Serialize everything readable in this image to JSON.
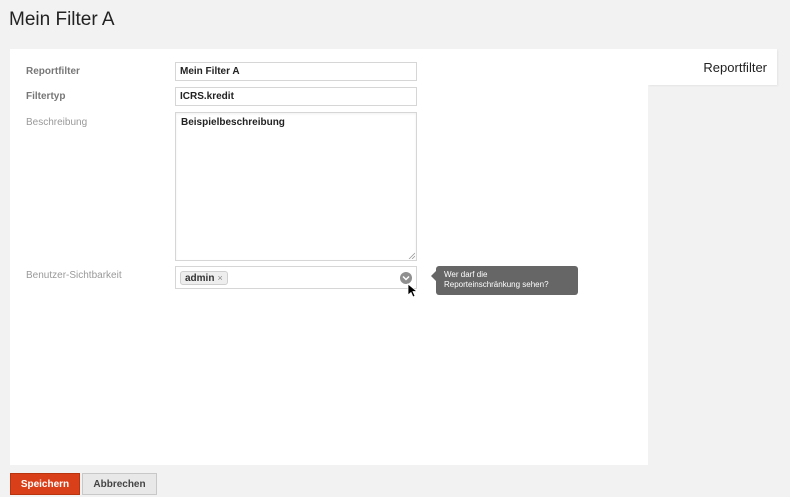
{
  "page": {
    "title": "Mein Filter A"
  },
  "side_tab": {
    "label": "Reportfilter"
  },
  "form": {
    "reportfilter": {
      "label": "Reportfilter",
      "value": "Mein Filter A"
    },
    "filtertyp": {
      "label": "Filtertyp",
      "value": "ICRS.kredit"
    },
    "beschreibung": {
      "label": "Beschreibung",
      "value": "Beispielbeschreibung"
    },
    "sichtbarkeit": {
      "label": "Benutzer-Sichtbarkeit",
      "tags": [
        "admin"
      ],
      "remove_glyph": "×",
      "dropdown_icon": "chevron-down-icon"
    }
  },
  "tooltip": {
    "line1": "Wer darf die",
    "line2": "Reporteinschränkung sehen?"
  },
  "buttons": {
    "save": "Speichern",
    "cancel": "Abbrechen"
  },
  "colors": {
    "primary_button": "#d9401a",
    "tooltip_bg": "#666666",
    "page_bg": "#f2f2f2"
  }
}
